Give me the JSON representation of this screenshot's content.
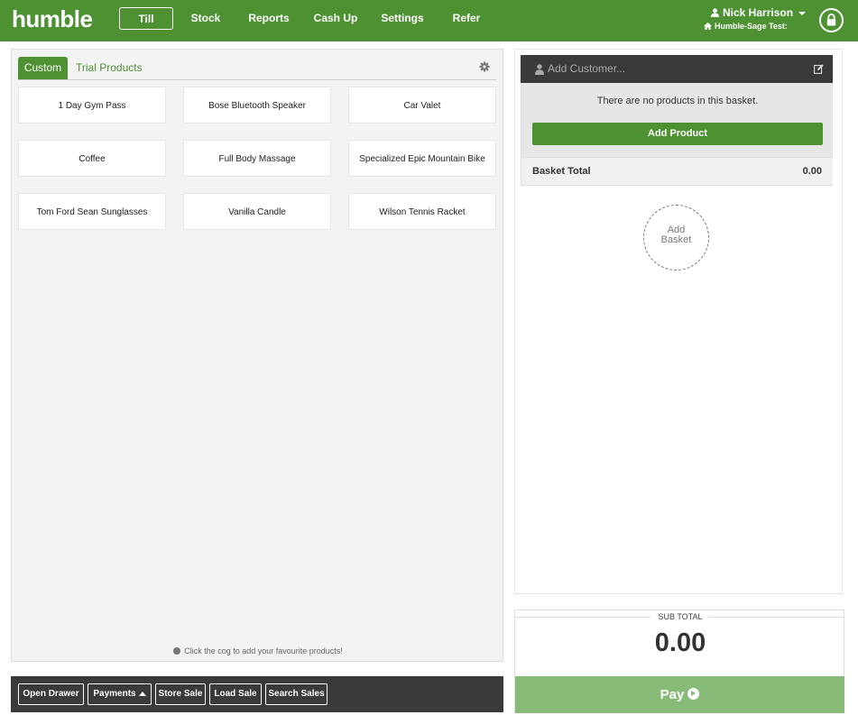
{
  "app": {
    "logo": "humble"
  },
  "nav": {
    "items": [
      {
        "label": "Till"
      },
      {
        "label": "Stock"
      },
      {
        "label": "Reports"
      },
      {
        "label": "Cash Up"
      },
      {
        "label": "Settings"
      },
      {
        "label": "Refer"
      }
    ],
    "active": "Till"
  },
  "user": {
    "name": "Nick Harrison",
    "store": "Humble-Sage Test:"
  },
  "products": {
    "tabs": [
      {
        "label": "Custom"
      },
      {
        "label": "Trial Products"
      }
    ],
    "items": [
      {
        "label": "1 Day Gym Pass"
      },
      {
        "label": "Bose Bluetooth Speaker"
      },
      {
        "label": "Car Valet"
      },
      {
        "label": "Coffee"
      },
      {
        "label": "Full Body Massage"
      },
      {
        "label": "Specialized Epic Mountain Bike"
      },
      {
        "label": "Tom Ford Sean Sunglasses"
      },
      {
        "label": "Vanilla Candle"
      },
      {
        "label": "Wilson Tennis Racket"
      }
    ],
    "hint": "Click the cog to add your favourite products!"
  },
  "toolbar": {
    "buttons": [
      {
        "label": "Open Drawer"
      },
      {
        "label": "Payments"
      },
      {
        "label": "Store Sale"
      },
      {
        "label": "Load Sale"
      },
      {
        "label": "Search Sales"
      }
    ]
  },
  "basket": {
    "customer_placeholder": "Add Customer...",
    "empty_message": "There are no products in this basket.",
    "add_product": "Add Product",
    "total_label": "Basket Total",
    "total_value": "0.00",
    "add_basket_line1": "Add",
    "add_basket_line2": "Basket"
  },
  "summary": {
    "sub_total_label": "SUB TOTAL",
    "sub_total_value": "0.00",
    "pay_label": "Pay"
  },
  "colors": {
    "brand_green": "#4e9133",
    "pay_green": "#88ba78",
    "dark_bar": "#3a3a3a"
  }
}
